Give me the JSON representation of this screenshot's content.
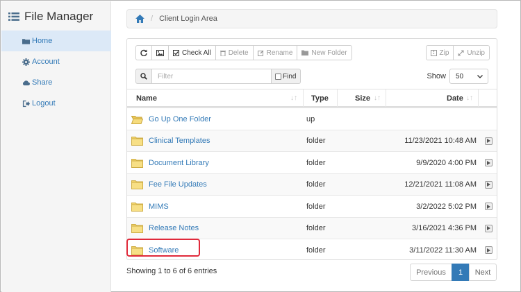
{
  "app": {
    "title": "File Manager"
  },
  "sidebar": {
    "items": [
      {
        "label": "Home",
        "icon": "folder-icon",
        "active": true
      },
      {
        "label": "Account",
        "icon": "gear-icon",
        "active": false
      },
      {
        "label": "Share",
        "icon": "cloud-icon",
        "active": false
      },
      {
        "label": "Logout",
        "icon": "logout-icon",
        "active": false
      }
    ]
  },
  "breadcrumb": {
    "home_icon": "home-icon",
    "current": "Client Login Area"
  },
  "toolbar": {
    "check_all": "Check All",
    "delete": "Delete",
    "rename": "Rename",
    "new_folder": "New Folder",
    "zip": "Zip",
    "unzip": "Unzip"
  },
  "filter": {
    "placeholder": "Filter",
    "find_label": "Find"
  },
  "show": {
    "label": "Show",
    "value": "50"
  },
  "table": {
    "headers": {
      "name": "Name",
      "type": "Type",
      "size": "Size",
      "date": "Date"
    },
    "rows": [
      {
        "name": "Go Up One Folder",
        "type": "up",
        "date": "",
        "icon": "open-folder-icon"
      },
      {
        "name": "Clinical Templates",
        "type": "folder",
        "date": "11/23/2021 10:48 AM",
        "icon": "folder-icon"
      },
      {
        "name": "Document Library",
        "type": "folder",
        "date": "9/9/2020 4:00 PM",
        "icon": "folder-icon"
      },
      {
        "name": "Fee File Updates",
        "type": "folder",
        "date": "12/21/2021 11:08 AM",
        "icon": "folder-icon"
      },
      {
        "name": "MIMS",
        "type": "folder",
        "date": "3/2/2022 5:02 PM",
        "icon": "folder-icon"
      },
      {
        "name": "Release Notes",
        "type": "folder",
        "date": "3/16/2021 4:36 PM",
        "icon": "folder-icon"
      },
      {
        "name": "Software",
        "type": "folder",
        "date": "3/11/2022 11:30 AM",
        "icon": "folder-icon"
      }
    ]
  },
  "footer": {
    "info": "Showing 1 to 6 of 6 entries",
    "prev": "Previous",
    "current_page": "1",
    "next": "Next"
  },
  "colors": {
    "link": "#337ab7",
    "highlight": "#e0293a",
    "folder": "#f2d46b"
  }
}
